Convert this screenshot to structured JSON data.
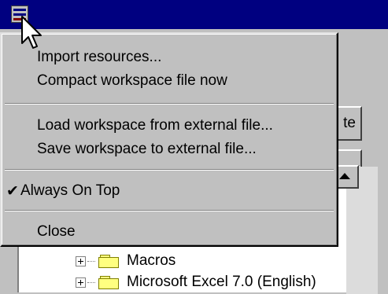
{
  "menu": {
    "items": [
      {
        "label": "Import resources...",
        "checked": false
      },
      {
        "label": "Compact workspace file now",
        "checked": false
      },
      {
        "label": "Load workspace from external file...",
        "checked": false
      },
      {
        "label": "Save workspace to external file...",
        "checked": false
      },
      {
        "label": "Always On Top",
        "checked": true
      },
      {
        "label": "Close",
        "checked": false
      }
    ],
    "check_glyph": "✔"
  },
  "buttons": {
    "partial_button_label": "te"
  },
  "tree": {
    "items": [
      {
        "label": "Macros",
        "icon": "folder-icon"
      },
      {
        "label": "Microsoft Excel 7.0 (English)",
        "icon": "folder-icon"
      }
    ]
  },
  "colors": {
    "titlebar": "#000080",
    "face": "#c0c0c0",
    "folder": "#ffff80"
  }
}
